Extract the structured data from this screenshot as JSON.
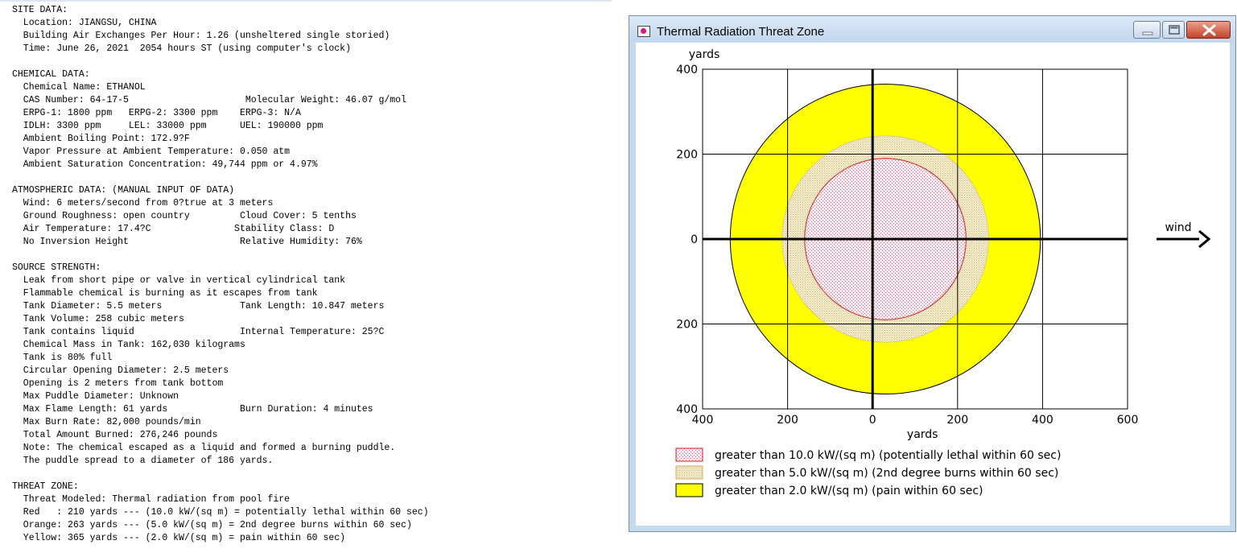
{
  "report": {
    "lines": [
      "SITE DATA:",
      "  Location: JIANGSU, CHINA",
      "  Building Air Exchanges Per Hour: 1.26 (unsheltered single storied)",
      "  Time: June 26, 2021  2054 hours ST (using computer's clock)",
      "",
      "CHEMICAL DATA:",
      "  Chemical Name: ETHANOL",
      "  CAS Number: 64-17-5                     Molecular Weight: 46.07 g/mol",
      "  ERPG-1: 1800 ppm   ERPG-2: 3300 ppm    ERPG-3: N/A",
      "  IDLH: 3300 ppm     LEL: 33000 ppm      UEL: 190000 ppm",
      "  Ambient Boiling Point: 172.9?F",
      "  Vapor Pressure at Ambient Temperature: 0.050 atm",
      "  Ambient Saturation Concentration: 49,744 ppm or 4.97%",
      "",
      "ATMOSPHERIC DATA: (MANUAL INPUT OF DATA)",
      "  Wind: 6 meters/second from 0?true at 3 meters",
      "  Ground Roughness: open country         Cloud Cover: 5 tenths",
      "  Air Temperature: 17.4?C               Stability Class: D",
      "  No Inversion Height                    Relative Humidity: 76%",
      "",
      "SOURCE STRENGTH:",
      "  Leak from short pipe or valve in vertical cylindrical tank",
      "  Flammable chemical is burning as it escapes from tank",
      "  Tank Diameter: 5.5 meters              Tank Length: 10.847 meters",
      "  Tank Volume: 258 cubic meters",
      "  Tank contains liquid                   Internal Temperature: 25?C",
      "  Chemical Mass in Tank: 162,030 kilograms",
      "  Tank is 80% full",
      "  Circular Opening Diameter: 2.5 meters",
      "  Opening is 2 meters from tank bottom",
      "  Max Puddle Diameter: Unknown",
      "  Max Flame Length: 61 yards             Burn Duration: 4 minutes",
      "  Max Burn Rate: 82,000 pounds/min",
      "  Total Amount Burned: 276,246 pounds",
      "  Note: The chemical escaped as a liquid and formed a burning puddle.",
      "  The puddle spread to a diameter of 186 yards.",
      "",
      "THREAT ZONE:",
      "  Threat Modeled: Thermal radiation from pool fire",
      "  Red   : 210 yards --- (10.0 kW/(sq m) = potentially lethal within 60 sec)",
      "  Orange: 263 yards --- (5.0 kW/(sq m) = 2nd degree burns within 60 sec)",
      "  Yellow: 365 yards --- (2.0 kW/(sq m) = pain within 60 sec)"
    ]
  },
  "window": {
    "title": "Thermal Radiation Threat Zone",
    "icons": [
      "app-icon",
      "minimize-icon",
      "maximize-icon",
      "close-icon"
    ]
  },
  "chart_data": {
    "type": "area",
    "title": "",
    "xlabel": "yards",
    "ylabel": "yards",
    "xlim": [
      -400,
      600
    ],
    "ylim": [
      -400,
      400
    ],
    "x_ticks": [
      -400,
      -200,
      0,
      200,
      400,
      600
    ],
    "x_tick_labels": [
      "400",
      "200",
      "0",
      "200",
      "400",
      "600"
    ],
    "y_ticks": [
      400,
      200,
      0,
      -200,
      -400
    ],
    "y_tick_labels": [
      "400",
      "200",
      "0",
      "200",
      "400"
    ],
    "grid": true,
    "wind_label": "wind",
    "wind_direction": "right",
    "zones": [
      {
        "name": "greater than 2.0 kW/(sq m) (pain within 60 sec)",
        "center": [
          30,
          0
        ],
        "radius": 365,
        "color": "#ffff00",
        "pattern": "solid"
      },
      {
        "name": "greater than 5.0 kW/(sq m) (2nd degree burns within 60 sec)",
        "center": [
          30,
          0
        ],
        "radius": 243,
        "color": "#f5ecc0",
        "pattern": "stipple-orange"
      },
      {
        "name": "greater than 10.0 kW/(sq m) (potentially lethal within 60 sec)",
        "center": [
          30,
          0
        ],
        "radius": 190,
        "color": "#fbeaf0",
        "pattern": "stipple-red"
      }
    ],
    "legend": [
      {
        "label": "greater than 10.0 kW/(sq m) (potentially lethal within 60 sec)",
        "pattern": "stipple-red"
      },
      {
        "label": "greater than 5.0 kW/(sq m) (2nd degree burns within 60 sec)",
        "pattern": "stipple-orange"
      },
      {
        "label": "greater than 2.0 kW/(sq m) (pain within 60 sec)",
        "pattern": "solid-yellow"
      }
    ],
    "legend_position": "bottom"
  }
}
